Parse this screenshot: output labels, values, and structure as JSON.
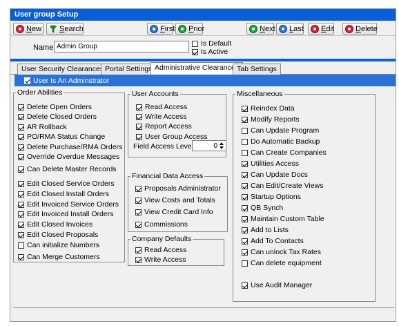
{
  "window": {
    "title": "User group Setup"
  },
  "toolbar": {
    "new": "New",
    "search": "Search",
    "first": "First",
    "prior": "Prior",
    "next": "Next",
    "last": "Last",
    "edit": "Edit",
    "delete": "Delete"
  },
  "header": {
    "name_label": "Name",
    "name_value": "Admin Group",
    "is_default": {
      "label": "Is Default",
      "checked": false
    },
    "is_active": {
      "label": "Is Active",
      "checked": true
    }
  },
  "tabs": [
    {
      "label": "User Security Clearances",
      "active": false
    },
    {
      "label": "Portal Settings",
      "active": false
    },
    {
      "label": "Administrative Clearances",
      "active": true
    },
    {
      "label": "Tab Settings",
      "active": false
    }
  ],
  "admin": {
    "label": "User Is An Adminstrator",
    "checked": true
  },
  "order_abilities": {
    "title": "Order Abilities",
    "items": [
      {
        "label": "Delete Open Orders",
        "checked": true
      },
      {
        "label": "Delete Closed Orders",
        "checked": true
      },
      {
        "label": "AR Rollback",
        "checked": true
      },
      {
        "label": "PO/RMA Status Change",
        "checked": true
      },
      {
        "label": "Delete Purchase/RMA Orders",
        "checked": true
      },
      {
        "label": "Override Overdue Messages",
        "checked": true
      },
      {
        "label": "Can Delete Master Records",
        "checked": true
      },
      {
        "label": "Edit Closed Service Orders",
        "checked": true
      },
      {
        "label": "Edit Closed Install Orders",
        "checked": true
      },
      {
        "label": "Edit Invoiced Service Orders",
        "checked": true
      },
      {
        "label": "Edit Invoiced Install Orders",
        "checked": true
      },
      {
        "label": "Edit Closed Invoices",
        "checked": true
      },
      {
        "label": "Edit Closed Proposals",
        "checked": true
      },
      {
        "label": "Can initialize Numbers",
        "checked": false
      },
      {
        "label": "Can Merge Customers",
        "checked": true
      }
    ]
  },
  "user_accounts": {
    "title": "User Accounts",
    "items": [
      {
        "label": "Read Access",
        "checked": true
      },
      {
        "label": "Write Access",
        "checked": true
      },
      {
        "label": "Report Access",
        "checked": true
      },
      {
        "label": "User Group Access",
        "checked": true
      }
    ],
    "field_access_label": "Field Access Level",
    "field_access_value": "0"
  },
  "financial": {
    "title": "Financial Data Access",
    "items": [
      {
        "label": "Proposals Administrator",
        "checked": true
      },
      {
        "label": "View Costs and Totals",
        "checked": true
      },
      {
        "label": "View Credit Card Info",
        "checked": true
      },
      {
        "label": "Commissions",
        "checked": true
      }
    ]
  },
  "company_defaults": {
    "title": "Company Defaults",
    "items": [
      {
        "label": "Read Access",
        "checked": true
      },
      {
        "label": "Write Access",
        "checked": true
      }
    ]
  },
  "misc": {
    "title": "Miscellaneous",
    "items": [
      {
        "label": "Reindex Data",
        "checked": true
      },
      {
        "label": "Modify Reports",
        "checked": true
      },
      {
        "label": "Can Update Program",
        "checked": false
      },
      {
        "label": "Do Automatic Backup",
        "checked": false
      },
      {
        "label": "Can Create Companies",
        "checked": false
      },
      {
        "label": "Utilities Access",
        "checked": true
      },
      {
        "label": "Can Update Docs",
        "checked": true
      },
      {
        "label": "Can Edit/Create Views",
        "checked": true
      },
      {
        "label": "Startup Options",
        "checked": true
      },
      {
        "label": "QB Synch",
        "checked": true
      },
      {
        "label": "Maintain Custom Table",
        "checked": true
      },
      {
        "label": "Add to Lists",
        "checked": true
      },
      {
        "label": "Add To Contacts",
        "checked": true
      },
      {
        "label": "Can unlock Tax Rates",
        "checked": true
      },
      {
        "label": "Can delete equipment",
        "checked": false
      },
      {
        "label": "Use Audit Manager",
        "checked": true
      }
    ]
  },
  "colors": {
    "title_bar": "#0a5fd8",
    "admin_bar": "#2a72d8"
  }
}
